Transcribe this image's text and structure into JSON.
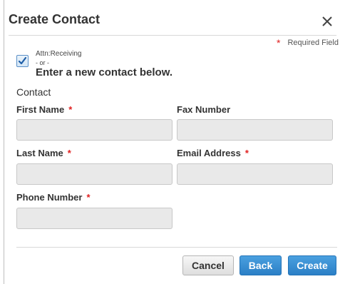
{
  "dialog": {
    "title": "Create Contact",
    "close_icon": "close-icon",
    "required_star": "*",
    "required_note": "Required Field"
  },
  "attention": {
    "checked": true,
    "label": "Attn:Receiving",
    "or_text": "- or -",
    "instruction": "Enter a new contact below."
  },
  "form": {
    "section_title": "Contact",
    "fields": {
      "first_name": {
        "label": "First Name",
        "required": "*",
        "value": ""
      },
      "fax_number": {
        "label": "Fax Number",
        "required": "",
        "value": ""
      },
      "last_name": {
        "label": "Last Name",
        "required": "*",
        "value": ""
      },
      "email_address": {
        "label": "Email Address",
        "required": "*",
        "value": ""
      },
      "phone_number": {
        "label": "Phone Number",
        "required": "*",
        "value": ""
      }
    }
  },
  "buttons": {
    "cancel": "Cancel",
    "back": "Back",
    "create": "Create"
  },
  "colors": {
    "primary": "#2b7fc6",
    "required": "#e02020",
    "input_bg": "#e9e9e9"
  }
}
